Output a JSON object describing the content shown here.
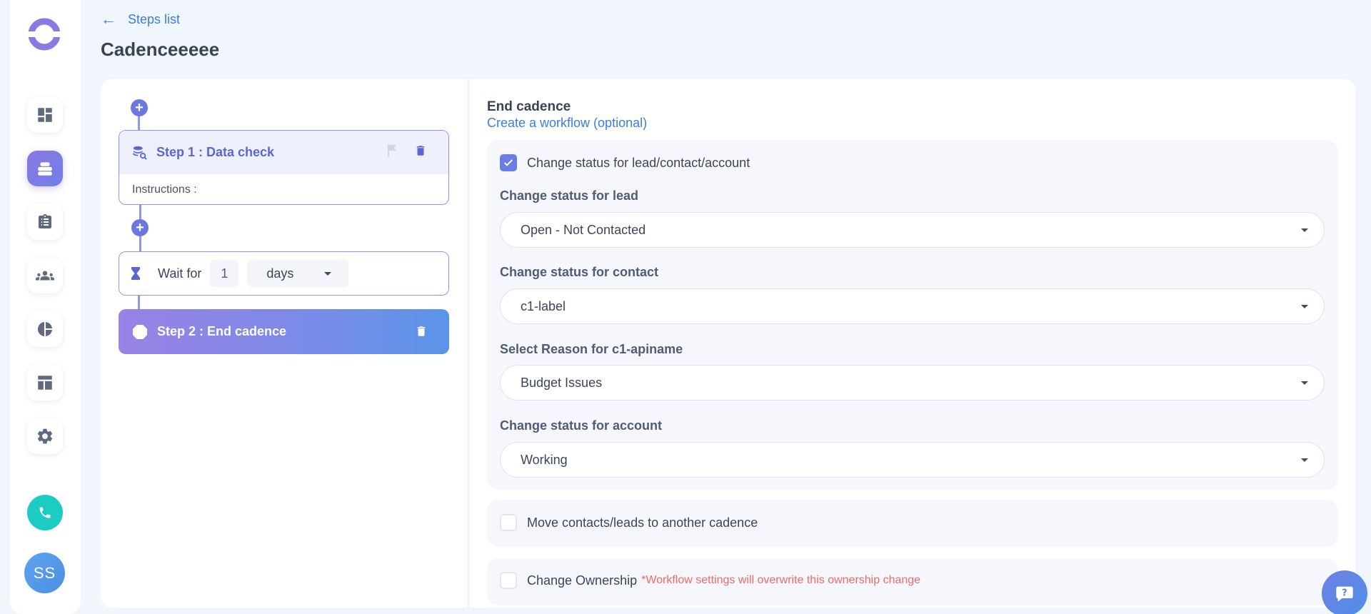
{
  "header": {
    "back_label": "Steps list",
    "page_title": "Cadenceeeee"
  },
  "sidebar": {
    "items": [
      {
        "icon": "dashboard-icon",
        "active": false
      },
      {
        "icon": "cadence-icon",
        "active": true
      },
      {
        "icon": "tasks-icon",
        "active": false
      },
      {
        "icon": "people-icon",
        "active": false
      },
      {
        "icon": "analytics-icon",
        "active": false
      },
      {
        "icon": "templates-icon",
        "active": false
      },
      {
        "icon": "settings-icon",
        "active": false
      }
    ],
    "call_icon": "phone-icon",
    "avatar_initials": "SS"
  },
  "steps": {
    "step1": {
      "title": "Step 1 : Data check",
      "instructions_label": "Instructions :",
      "icon": "data-check-icon"
    },
    "wait": {
      "label": "Wait for",
      "value": "1",
      "unit": "days",
      "icon": "hourglass-icon"
    },
    "step2": {
      "title": "Step 2 : End cadence",
      "icon": "stop-icon"
    }
  },
  "end_cadence": {
    "title": "End cadence",
    "subtitle": "Create a workflow (optional)",
    "change_status": {
      "checked": true,
      "label": "Change status for lead/contact/account",
      "lead_label": "Change status for lead",
      "lead_value": "Open - Not Contacted",
      "contact_label": "Change status for contact",
      "contact_value": "c1-label",
      "reason_label": "Select Reason for c1-apiname",
      "reason_value": "Budget Issues",
      "account_label": "Change status for account",
      "account_value": "Working"
    },
    "move": {
      "checked": false,
      "label": "Move contacts/leads to another cadence"
    },
    "ownership": {
      "checked": false,
      "label": "Change Ownership",
      "warning": "*Workflow settings will overwrite this ownership change"
    }
  },
  "colors": {
    "accent": "#6b7de2",
    "link": "#3a7ee0",
    "warning": "#f06a65",
    "call": "#1ccbc2"
  }
}
